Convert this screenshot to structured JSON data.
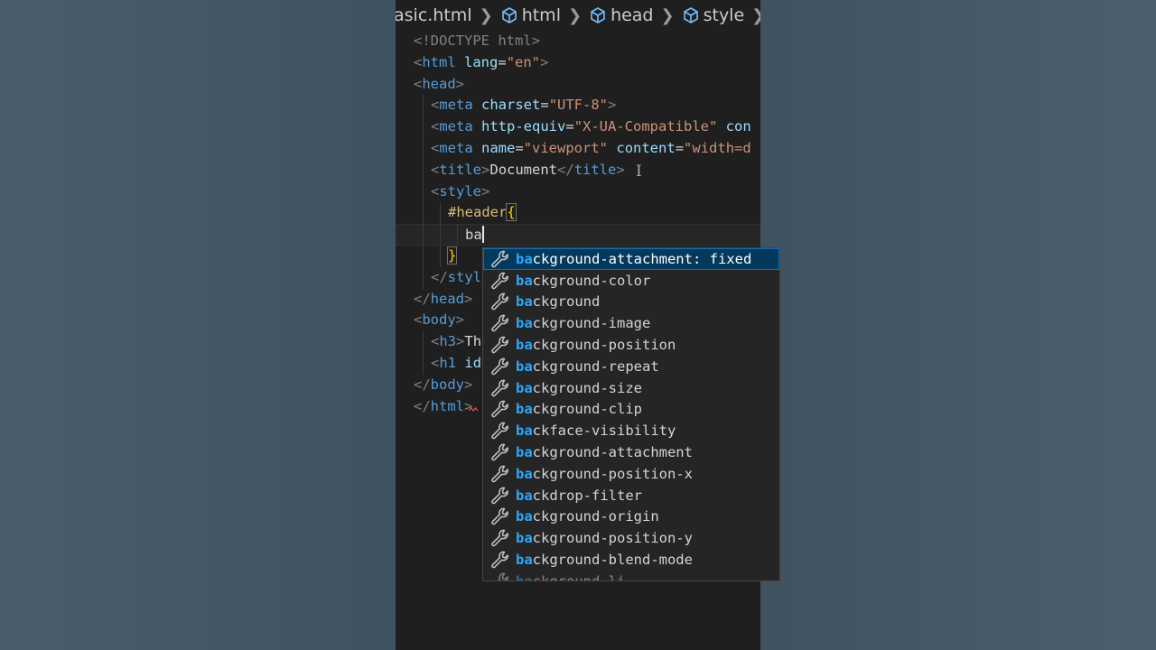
{
  "breadcrumb": [
    {
      "label": "asic.html",
      "icon": "none"
    },
    {
      "label": "html",
      "icon": "cube-icon"
    },
    {
      "label": "head",
      "icon": "cube-icon"
    },
    {
      "label": "style",
      "icon": "cube-icon"
    }
  ],
  "code": {
    "doctype": "<!DOCTYPE html>",
    "html_open": "html",
    "lang_attr": "lang",
    "lang_value": "\"en\"",
    "head_open": "head",
    "meta1_tag": "meta",
    "meta1_attr": "charset",
    "meta1_value": "\"UTF-8\"",
    "meta2_tag": "meta",
    "meta2_attr": "http-equiv",
    "meta2_value": "\"X-UA-Compatible\"",
    "meta2_rest": "con",
    "meta3_tag": "meta",
    "meta3_attr": "name",
    "meta3_value": "\"viewport\"",
    "meta3_attr2": "content",
    "meta3_value2": "\"width=d",
    "title_tag": "title",
    "title_text": "Document",
    "style_tag": "style",
    "selector": "#header",
    "typed": "ba",
    "style_close_partial": "styl",
    "head_close": "head",
    "body_open": "body",
    "h3_tag": "h3",
    "h3_text": "Th",
    "h1_tag": "h1",
    "h1_attr": "id",
    "body_close": "body",
    "html_close": "html"
  },
  "suggest": {
    "match": "ba",
    "items": [
      {
        "rest": "ckground-attachment: fixed",
        "active": true
      },
      {
        "rest": "ckground-color"
      },
      {
        "rest": "ckground"
      },
      {
        "rest": "ckground-image"
      },
      {
        "rest": "ckground-position"
      },
      {
        "rest": "ckground-repeat"
      },
      {
        "rest": "ckground-size"
      },
      {
        "rest": "ckground-clip"
      },
      {
        "rest": "ckface-visibility"
      },
      {
        "rest": "ckground-attachment"
      },
      {
        "rest": "ckground-position-x"
      },
      {
        "rest": "ckdrop-filter"
      },
      {
        "rest": "ckground-origin"
      },
      {
        "rest": "ckground-position-y"
      },
      {
        "rest": "ckground-blend-mode"
      },
      {
        "rest": "ckground-li"
      }
    ]
  },
  "colors": {
    "background": "#3b4d5b",
    "editor": "#1f1f1f",
    "tag": "#569cd6",
    "attribute": "#9cdcfe",
    "string": "#ce9178",
    "selector": "#d7ba7d",
    "suggest_bg": "#252526",
    "suggest_active": "#04395e",
    "match_highlight": "#2aaaff"
  }
}
